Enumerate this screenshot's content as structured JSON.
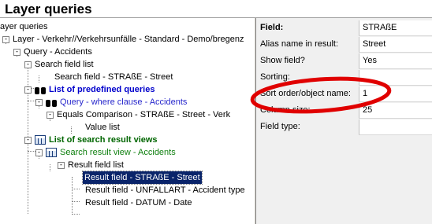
{
  "window": {
    "title": "Layer queries"
  },
  "tree": {
    "header": "ayer queries",
    "items": [
      {
        "label": "Layer - Verkehr//Verkehrsunfälle - Standard - Demo/bregenz",
        "expander": "-",
        "style": "plain"
      },
      {
        "label": "Query - Accidents",
        "expander": "-",
        "style": "plain"
      },
      {
        "label": "Search field list",
        "expander": "-",
        "style": "plain"
      },
      {
        "label": "Search field - STRAßE - Street",
        "expander": "",
        "style": "plain"
      },
      {
        "label": "List of predefined queries",
        "expander": "-",
        "icon": "binoculars-icon",
        "style": "blue-bold"
      },
      {
        "label": "Query - where clause - Accidents",
        "expander": "-",
        "icon": "binoculars-icon",
        "style": "blue"
      },
      {
        "label": "Equals Comparison - STRAßE - Street - Verk",
        "expander": "-",
        "style": "plain"
      },
      {
        "label": "Value list",
        "expander": "",
        "style": "plain"
      },
      {
        "label": "List of search result views",
        "expander": "-",
        "icon": "table-grid-icon",
        "style": "green-bold"
      },
      {
        "label": "Search result view - Accidents",
        "expander": "-",
        "icon": "table-grid-icon",
        "style": "green"
      },
      {
        "label": "Result field list",
        "expander": "-",
        "style": "plain"
      },
      {
        "label": "Result field - STRAßE - Street",
        "expander": "",
        "style": "selected"
      },
      {
        "label": "Result field - UNFALLART - Accident type",
        "expander": "",
        "style": "plain"
      },
      {
        "label": "Result field - DATUM - Date",
        "expander": "",
        "style": "plain"
      }
    ]
  },
  "properties": {
    "rows": [
      {
        "label": "Field:",
        "value": "STRAßE",
        "bold": true
      },
      {
        "label": "Alias name in result:",
        "value": "Street",
        "bold": false
      },
      {
        "label": "Show field?",
        "value": "Yes",
        "bold": false
      },
      {
        "label": "Sorting:",
        "value": "",
        "bold": false
      },
      {
        "label": "Sort order/object name:",
        "value": "1",
        "bold": false
      },
      {
        "label": "Column size:",
        "value": "25",
        "bold": false
      },
      {
        "label": "Field type:",
        "value": "",
        "bold": false
      }
    ]
  },
  "colors": {
    "annotation": "#e00000",
    "selection": "#0a246a",
    "query_blue": "#0000cc",
    "result_green": "#006600"
  }
}
